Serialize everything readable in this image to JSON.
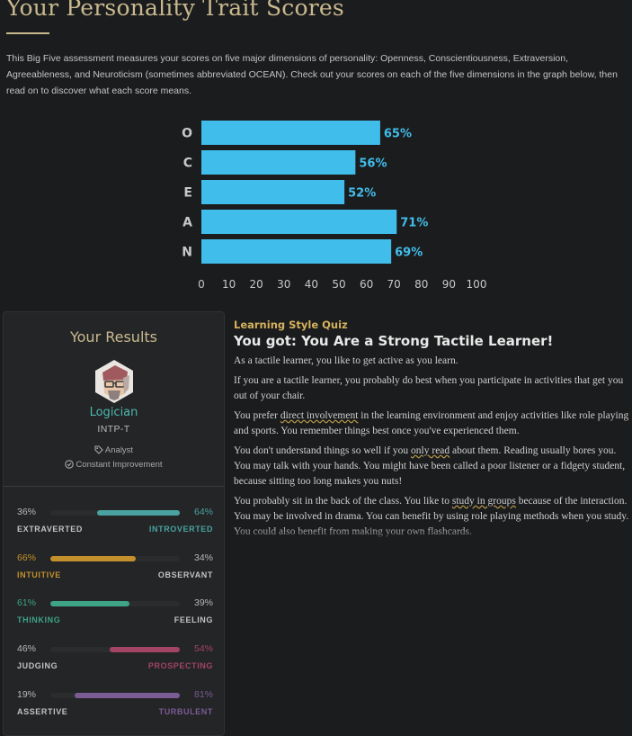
{
  "page": {
    "title": "Your Personality Trait Scores",
    "intro": "This Big Five assessment measures your scores on five major dimensions of personality: Openness, Conscientiousness, Extraversion, Agreeableness, and Neuroticism (sometimes abbreviated OCEAN). Check out your scores on each of the five dimensions in the graph below, then read on to discover what each score means."
  },
  "chart_data": {
    "type": "bar",
    "orientation": "horizontal",
    "categories": [
      "O",
      "C",
      "E",
      "A",
      "N"
    ],
    "values": [
      65,
      56,
      52,
      71,
      69
    ],
    "value_labels": [
      "65%",
      "56%",
      "52%",
      "71%",
      "69%"
    ],
    "xlim": [
      0,
      100
    ],
    "xticks": [
      0,
      10,
      20,
      30,
      40,
      50,
      60,
      70,
      80,
      90,
      100
    ],
    "grid": false,
    "bar_color": "#41bdeb",
    "title": "",
    "xlabel": "",
    "ylabel": ""
  },
  "results": {
    "heading": "Your Results",
    "type_name": "Logician",
    "type_code": "INTP-T",
    "role": "Analyst",
    "strategy": "Constant Improvement",
    "role_icon": "tag-icon",
    "strategy_icon": "check-circle-icon",
    "traits": [
      {
        "left_pct": "36%",
        "right_pct": "64%",
        "left_label": "EXTRAVERTED",
        "right_label": "INTROVERTED",
        "dominant": "right",
        "value": 64,
        "color": "#4aa3a0"
      },
      {
        "left_pct": "66%",
        "right_pct": "34%",
        "left_label": "INTUITIVE",
        "right_label": "OBSERVANT",
        "dominant": "left",
        "value": 66,
        "color": "#c4902c"
      },
      {
        "left_pct": "61%",
        "right_pct": "39%",
        "left_label": "THINKING",
        "right_label": "FEELING",
        "dominant": "left",
        "value": 61,
        "color": "#3fa386"
      },
      {
        "left_pct": "46%",
        "right_pct": "54%",
        "left_label": "JUDGING",
        "right_label": "PROSPECTING",
        "dominant": "right",
        "value": 54,
        "color": "#a24463"
      },
      {
        "left_pct": "19%",
        "right_pct": "81%",
        "left_label": "ASSERTIVE",
        "right_label": "TURBULENT",
        "dominant": "right",
        "value": 81,
        "color": "#7b5c95"
      }
    ]
  },
  "quiz": {
    "kicker": "Learning Style Quiz",
    "heading": "You got: You Are a Strong Tactile Learner!",
    "p1": "As a tactile learner, you like to get active as you learn.",
    "p2": "If you are a tactile learner, you probably do best when you participate in activities that get you out of your chair.",
    "p3_a": "You prefer ",
    "p3_hl": "direct involvement",
    "p3_b": " in the learning environment and enjoy activities like role playing and sports. You remember things best once you've experienced them.",
    "p4_a": "You don't understand things so well if you ",
    "p4_hl": "only read",
    "p4_b": " about them. Reading usually bores you. You may talk with your hands. You might have been called a poor listener or a fidgety student, because sitting too long makes you nuts!",
    "p5_a": "You probably sit in the back of the class. You like to ",
    "p5_hl": "study in groups",
    "p5_b": " because of the interaction. You may be involved in drama. You can benefit by using role playing methods when you study. You could also benefit from making your own flashcards."
  }
}
